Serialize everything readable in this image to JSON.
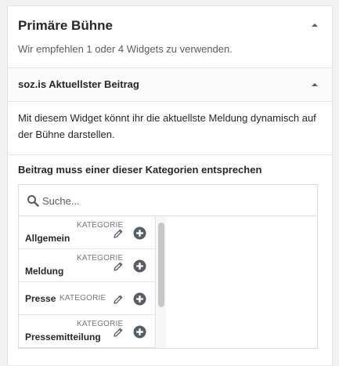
{
  "area": {
    "title": "Primäre Bühne",
    "description": "Wir empfehlen 1 oder 4 Widgets zu verwenden."
  },
  "widget": {
    "title": "soz.is Aktuellster Beitrag",
    "description": "Mit diesem Widget könnt ihr die aktuellste Meldung dynamisch auf der Bühne darstellen."
  },
  "field": {
    "label": "Beitrag muss einer dieser Kategorien entsprechen",
    "search_placeholder": "Suche..."
  },
  "choices": [
    {
      "kind": "KATEGORIE",
      "name": "Allgemein"
    },
    {
      "kind": "KATEGORIE",
      "name": "Meldung"
    },
    {
      "kind": "KATEGORIE",
      "name": "Presse"
    },
    {
      "kind": "KATEGORIE",
      "name": "Pressemitteilung"
    }
  ],
  "icons": {
    "toggle": "arrow-up-icon",
    "search": "search-icon",
    "edit": "pencil-icon",
    "add": "plus-circle-icon"
  },
  "colors": {
    "text": "#23282d",
    "muted": "#72777c",
    "border": "#e5e5e5"
  }
}
